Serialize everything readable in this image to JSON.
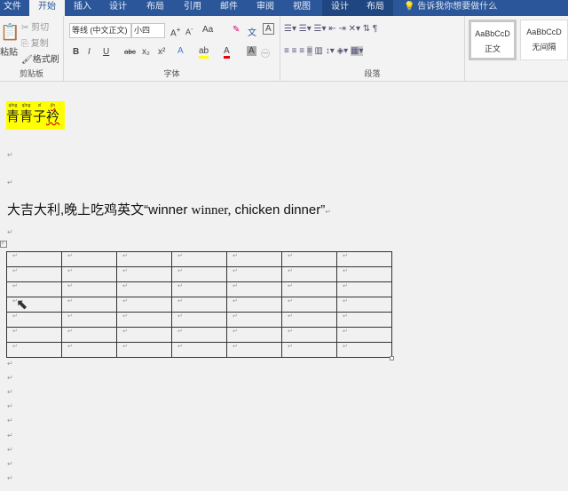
{
  "tabs": [
    "文件",
    "开始",
    "插入",
    "设计",
    "布局",
    "引用",
    "邮件",
    "审阅",
    "视图",
    "设计",
    "布局"
  ],
  "active_tab": "开始",
  "tell_me": "告诉我你想要做什么",
  "clipboard": {
    "paste": "粘贴",
    "cut": "剪切",
    "copy": "复制",
    "format_painter": "格式刷",
    "label": "剪贴板"
  },
  "font": {
    "name": "等线 (中文正文)",
    "size": "小四",
    "case": "Aa",
    "label": "字体",
    "bold": "B",
    "italic": "I",
    "underline": "U",
    "strike": "abc",
    "sub": "x₂",
    "sup": "x²"
  },
  "paragraph": {
    "label": "段落"
  },
  "styles": [
    {
      "preview": "AaBbCcD",
      "name": "正文"
    },
    {
      "preview": "AaBbCcD",
      "name": "无间隔"
    }
  ],
  "document": {
    "title_chars": [
      {
        "py": "qīng",
        "ch": "青"
      },
      {
        "py": "qīng",
        "ch": "青"
      },
      {
        "py": "zǐ",
        "ch": "子"
      },
      {
        "py": "jīn",
        "ch": "衿"
      }
    ],
    "sentence_a": "大吉大利,晚上吃鸡英文“winner ",
    "sentence_b": "winner,",
    "sentence_c": " chicken dinner”",
    "return_mark": "↵",
    "table": {
      "rows": 7,
      "cols": 7
    }
  },
  "colors": {
    "tab_bar": "#2b579a",
    "highlight": "#ffff00"
  }
}
